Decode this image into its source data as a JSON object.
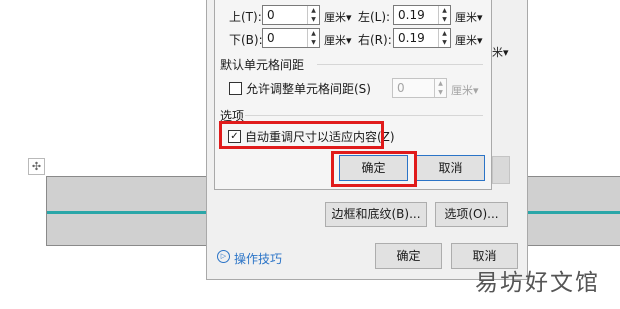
{
  "document": {
    "move_handle_glyph": "✣",
    "table_line_color": "#2aa6a8"
  },
  "outer_dialog": {
    "right_unit_fragment": "米▾",
    "borders_button": "边框和底纹(B)...",
    "options_button": "选项(O)...",
    "tips_link": "操作技巧",
    "tips_icon_glyph": "▷",
    "ok_button": "确定",
    "cancel_button": "取消"
  },
  "inner_dialog": {
    "margins": {
      "top_label": "上(T):",
      "top_value": "0",
      "top_unit": "厘米▾",
      "left_label": "左(L):",
      "left_value": "0.19",
      "left_unit": "厘米▾",
      "bottom_label": "下(B):",
      "bottom_value": "0",
      "bottom_unit": "厘米▾",
      "right_label": "右(R):",
      "right_value": "0.19",
      "right_unit": "厘米▾"
    },
    "spacing": {
      "section_title": "默认单元格间距",
      "allow_spacing_label": "允许调整单元格间距(S)",
      "allow_spacing_checked": false,
      "spacing_value": "0",
      "spacing_unit": "厘米▾"
    },
    "options": {
      "section_title": "选项",
      "autofit_label": "自动重调尺寸以适应内容(Z)",
      "autofit_checked": true,
      "check_glyph": "✓"
    },
    "ok_button": "确定",
    "cancel_button": "取消",
    "spin_up": "▲",
    "spin_down": "▼"
  },
  "watermark": "易坊好文馆",
  "colors": {
    "highlight": "#e01b1b",
    "accent": "#2b74c7"
  }
}
